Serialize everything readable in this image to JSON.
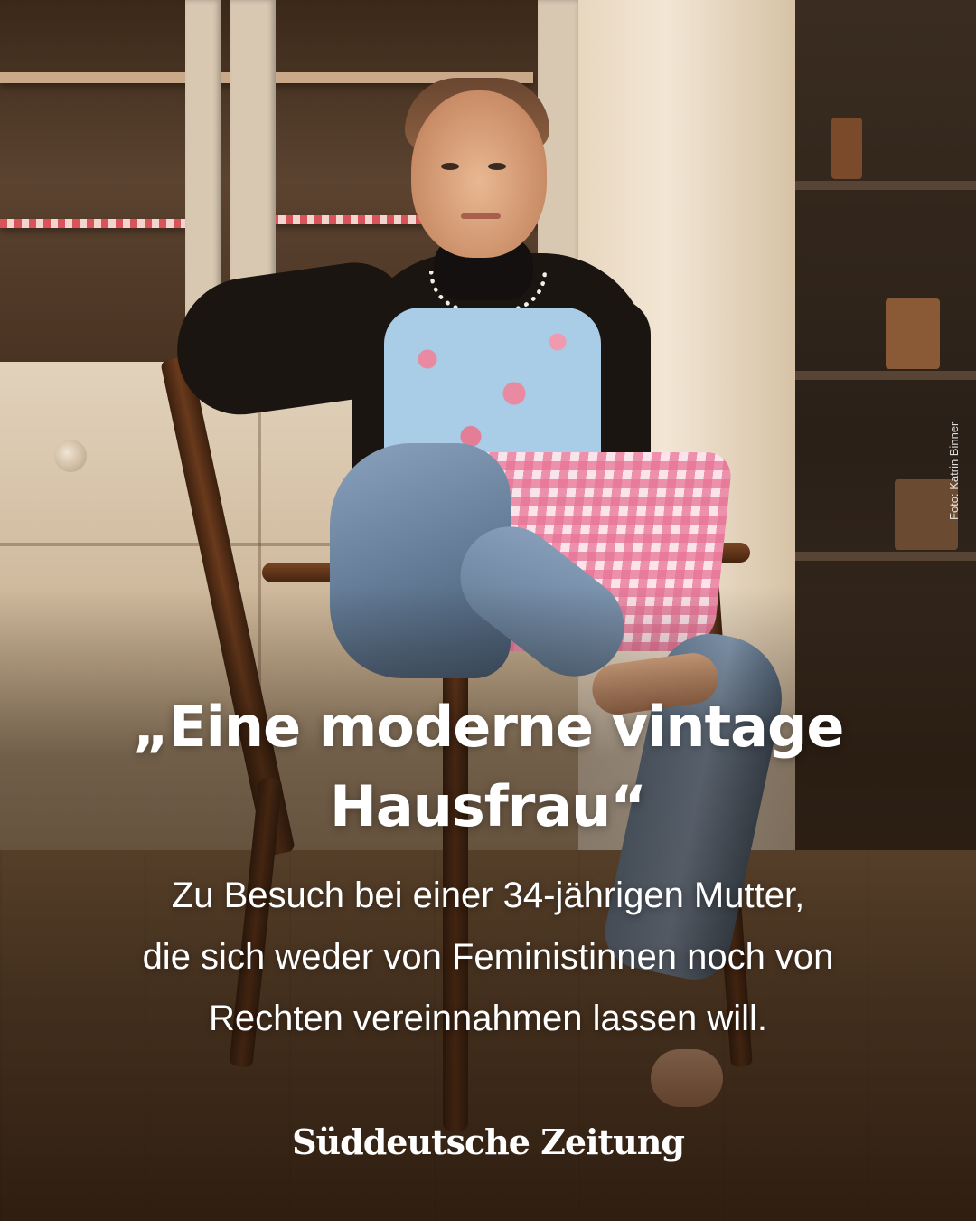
{
  "photo": {
    "alt_subject": "woman-sitting-on-wooden-chair-in-kitchen",
    "credit": "Foto: Katrin Binner"
  },
  "headline": {
    "line1": "„Eine moderne vintage",
    "line2": "Hausfrau“"
  },
  "subline": {
    "line1": "Zu Besuch bei einer 34-jährigen Mutter,",
    "line2": "die sich weder von Feministinnen noch von",
    "line3": "Rechten vereinnahmen lassen will."
  },
  "brand": {
    "logo_text": "Süddeutsche Zeitung"
  },
  "colors": {
    "text": "#ffffff",
    "apron_blue": "#a9cde6",
    "apron_pink": "#e774a0",
    "jeans": "#6d86a0",
    "sweater": "#1b1512"
  }
}
